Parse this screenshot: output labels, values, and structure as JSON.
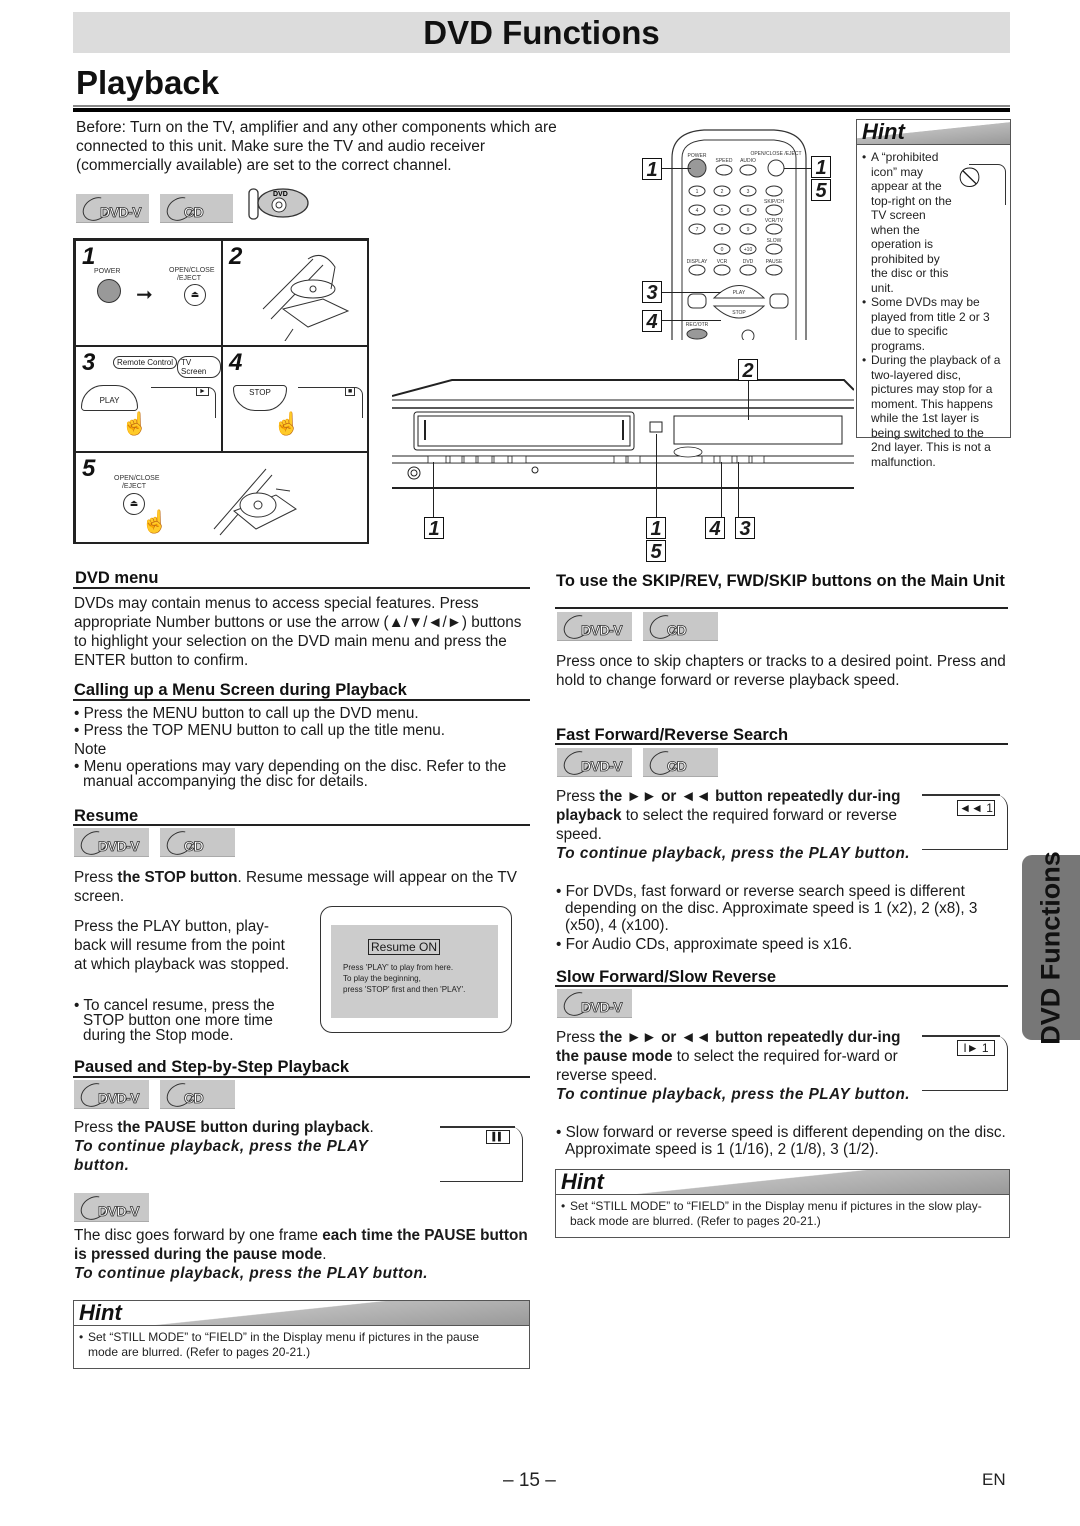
{
  "header": {
    "banner": "DVD Functions",
    "page_title": "Playback"
  },
  "intro": "Before: Turn on the TV, amplifier and any other components which are connected to this unit. Make sure the TV and audio receiver (commercially available) are set to the correct channel.",
  "badges": {
    "dvd": "DVD-V",
    "cd": "CD",
    "disc_label": "DVD"
  },
  "steps": {
    "s1": {
      "num": "1",
      "power": "POWER",
      "open_close": "OPEN/CLOSE /EJECT"
    },
    "s2": {
      "num": "2"
    },
    "s3": {
      "num": "3",
      "bubble_remote": "Remote Control",
      "bubble_tv": "TV Screen",
      "play": "PLAY"
    },
    "s4": {
      "num": "4",
      "stop": "STOP"
    },
    "s5": {
      "num": "5",
      "open_close": "OPEN/CLOSE /EJECT"
    }
  },
  "remote": {
    "labels": {
      "power": "POWER",
      "speed": "SPEED",
      "audio": "AUDIO",
      "open_close": "OPEN/CLOSE /EJECT",
      "skip_ch": "SKIP/CH",
      "vcr_tv": "VCR/TV",
      "slow": "SLOW",
      "display": "DISPLAY",
      "vcr": "VCR",
      "dvd": "DVD",
      "pause": "PAUSE",
      "play": "PLAY",
      "stop": "STOP",
      "rec_otr": "REC/OTR"
    },
    "digits": [
      "1",
      "2",
      "3",
      "4",
      "5",
      "6",
      "7",
      "8",
      "9",
      "0",
      "+10"
    ],
    "callouts": {
      "power": "1",
      "eject_a": "1",
      "eject_b": "5",
      "play": "3",
      "stop": "4"
    }
  },
  "unit_callouts": {
    "tray": "2",
    "power": "1",
    "eject_a": "1",
    "eject_b": "5",
    "stop": "4",
    "play": "3"
  },
  "hint_top": {
    "title": "Hint",
    "items": [
      "A “prohibited icon” may appear at the top-right on the TV screen when the operation is prohibited by the disc or this unit.",
      "Some DVDs may be played from title 2 or 3 due to specific programs.",
      "During the playback of a two-layered disc, pictures may stop for a moment. This happens while the 1st layer is being switched to the 2nd layer. This is not a malfunction."
    ]
  },
  "dvd_menu": {
    "title": "DVD menu",
    "body": "DVDs may contain menus to access special features. Press appropriate Number buttons or use the arrow (▲/▼/◄/►) buttons to highlight your selection on the DVD main menu and press the ENTER button to confirm."
  },
  "calling_menu": {
    "title": "Calling up a Menu Screen during Playback",
    "bullets": [
      "Press the MENU button to call up the DVD menu.",
      "Press the TOP MENU button to call up the title menu."
    ],
    "note_label": "Note",
    "note": "Menu operations may vary depending on the disc. Refer to the manual accompanying the disc for details."
  },
  "resume": {
    "title": "Resume",
    "p1_pre": "Press ",
    "p1_bold": "the STOP button",
    "p1_post": ". Resume message will appear on the TV screen.",
    "p2": "Press the PLAY button, play-back will resume from the point at which playback was stopped.",
    "bullet": "To cancel resume, press the STOP button one more time during the Stop mode.",
    "osd_title": "Resume ON",
    "osd_lines": [
      "Press 'PLAY' to play from here.",
      "To play the beginning,",
      "press 'STOP' first and then 'PLAY'."
    ]
  },
  "paused": {
    "title": "Paused and Step-by-Step Playback",
    "p1_pre": "Press ",
    "p1_bold": "the PAUSE button during playback",
    "p1_post": ".",
    "cont": "To continue playback, press the PLAY button.",
    "osd": "▌▌",
    "p2_pre": "The disc goes forward by one frame ",
    "p2_bold": "each time the PAUSE button is pressed during the pause mode",
    "p2_post": ".",
    "cont2": "To continue playback, press the PLAY button."
  },
  "hint_left": {
    "title": "Hint",
    "text": "Set “STILL MODE” to “FIELD” in the Display menu if pictures in the pause mode are blurred. (Refer to pages 20-21.)"
  },
  "skip": {
    "title": "To use the SKIP/REV, FWD/SKIP buttons on the Main Unit",
    "body": "Press once to skip chapters or tracks to a desired point. Press and hold to change forward or reverse playback speed."
  },
  "fast": {
    "title": "Fast Forward/Reverse Search",
    "p_pre": "Press ",
    "p_bold": "the ►► or ◄◄ button repeatedly dur-ing playback",
    "p_post": " to select the required forward or reverse speed.",
    "cont": "To continue playback, press the PLAY button.",
    "osd": "◄◄ 1",
    "bullets": [
      "For DVDs, fast forward or reverse search speed is different depending on the disc. Approximate speed is 1 (x2), 2 (x8), 3 (x50), 4 (x100).",
      "For Audio CDs, approximate speed is x16."
    ]
  },
  "slow": {
    "title": "Slow Forward/Slow Reverse",
    "p_pre": "Press ",
    "p_bold": "the ►► or ◄◄ button repeatedly dur-ing the pause mode",
    "p_post": " to select the required for-ward or reverse speed.",
    "cont": "To continue playback, press the PLAY button.",
    "osd": "I► 1",
    "bullet": "Slow forward or reverse speed is different depending on the disc. Approximate speed is 1 (1/16), 2 (1/8), 3 (1/2)."
  },
  "hint_right": {
    "title": "Hint",
    "text": "Set “STILL MODE”  to “FIELD” in the Display menu if pictures in the slow play-back mode are blurred. (Refer to pages 20-21.)"
  },
  "side_tab": "DVD Functions",
  "footer": {
    "page": "– 15 –",
    "lang": "EN"
  }
}
